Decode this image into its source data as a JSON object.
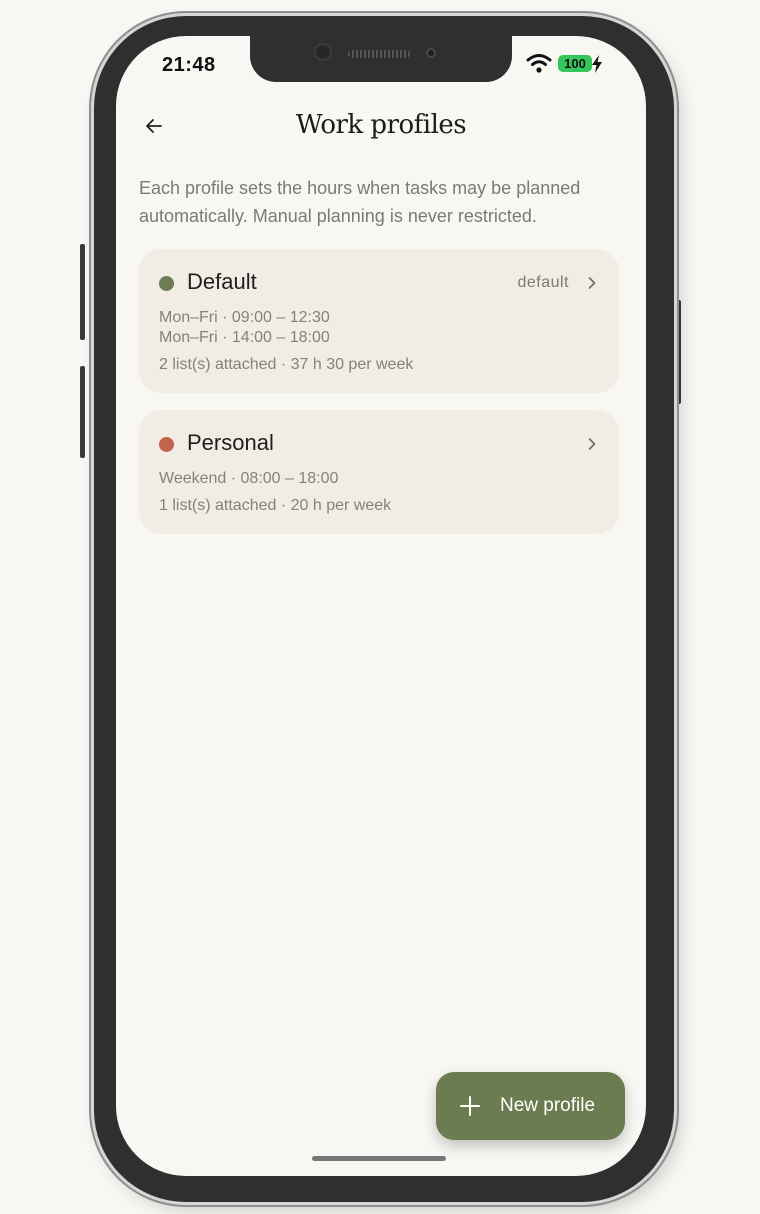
{
  "status_bar": {
    "time": "21:48",
    "battery": "100"
  },
  "header": {
    "title": "Work profiles"
  },
  "intro": "Each profile sets the hours when tasks may be planned automatically. Manual planning is never restricted.",
  "profiles": [
    {
      "name": "Default",
      "badge": "default",
      "color": "#6b7c50",
      "schedule": [
        "Mon–Fri · 09:00 – 12:30",
        "Mon–Fri · 14:00 – 18:00"
      ],
      "summary": "2 list(s) attached · 37 h 30 per week"
    },
    {
      "name": "Personal",
      "badge": "",
      "color": "#c0644e",
      "schedule": [
        "Weekend · 08:00 – 18:00"
      ],
      "summary": "1 list(s) attached · 20 h per week"
    }
  ],
  "fab": {
    "label": "New profile"
  },
  "colors": {
    "accent": "#6b7c50",
    "card_bg": "#f1ece4",
    "battery": "#34c759"
  },
  "icons": {
    "back": "arrow-left-icon",
    "wifi": "wifi-icon",
    "charging": "bolt-icon",
    "chevron": "chevron-right-icon",
    "add": "plus-icon"
  }
}
